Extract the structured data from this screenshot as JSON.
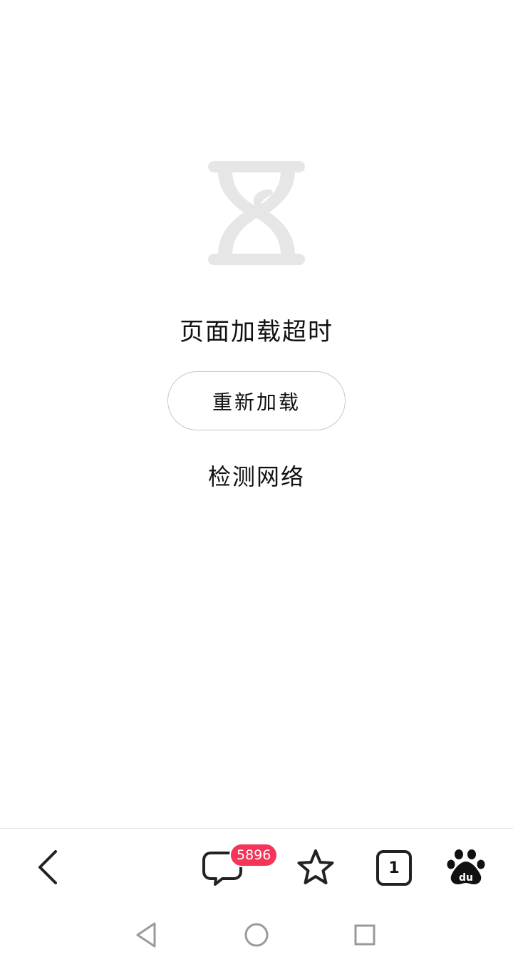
{
  "error": {
    "title": "页面加载超时",
    "reload_label": "重新加载",
    "check_network_label": "检测网络",
    "icon": "hourglass-icon"
  },
  "toolbar": {
    "back_icon": "chevron-left-icon",
    "messages_icon": "chat-bubble-icon",
    "messages_badge": "5896",
    "favorites_icon": "star-icon",
    "tabs_icon": "tabs-icon",
    "tabs_count": "1",
    "home_icon": "baidu-paw-icon"
  },
  "system_nav": {
    "back_icon": "triangle-back-icon",
    "home_icon": "circle-home-icon",
    "recents_icon": "square-recents-icon"
  },
  "colors": {
    "badge": "#f5345a",
    "hourglass": "#e6e6e6",
    "text": "#111111",
    "border": "#c8c8c8"
  }
}
